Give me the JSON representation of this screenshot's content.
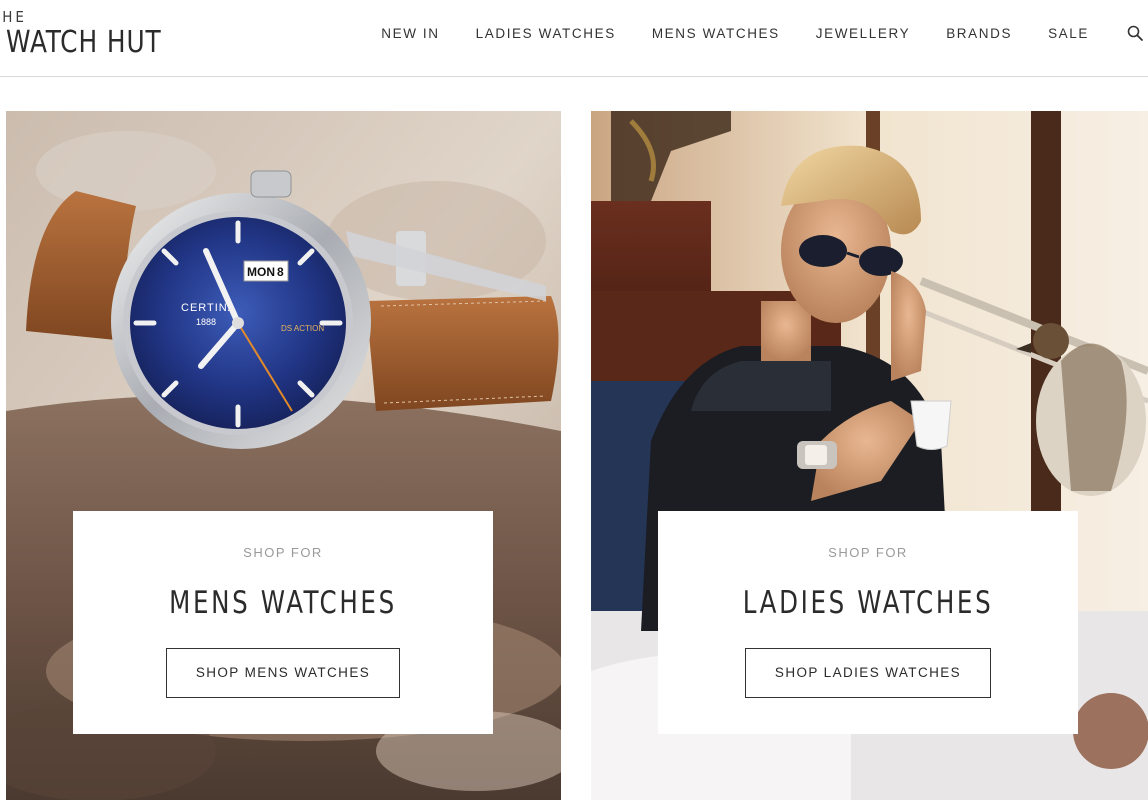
{
  "header": {
    "logo_top": "THE",
    "logo_main": "WATCH HUT",
    "nav": [
      "NEW IN",
      "LADIES WATCHES",
      "MENS WATCHES",
      "JEWELLERY",
      "BRANDS",
      "SALE"
    ]
  },
  "icons": {
    "search": "search-icon"
  },
  "panels": {
    "mens": {
      "eyebrow": "SHOP FOR",
      "title": "MENS WATCHES",
      "button": "SHOP MENS WATCHES",
      "dial_brand": "CERTINA",
      "dial_year": "1888",
      "dial_day": "MON",
      "dial_date": "8",
      "dial_model": "DS ACTION"
    },
    "ladies": {
      "eyebrow": "SHOP FOR",
      "title": "LADIES WATCHES",
      "button": "SHOP LADIES WATCHES"
    }
  },
  "colors": {
    "dial_blue": "#1f2f7a",
    "strap_brown": "#9a5a30",
    "text_dark": "#2b2b2b",
    "eyebrow_grey": "#9a9a9a"
  }
}
